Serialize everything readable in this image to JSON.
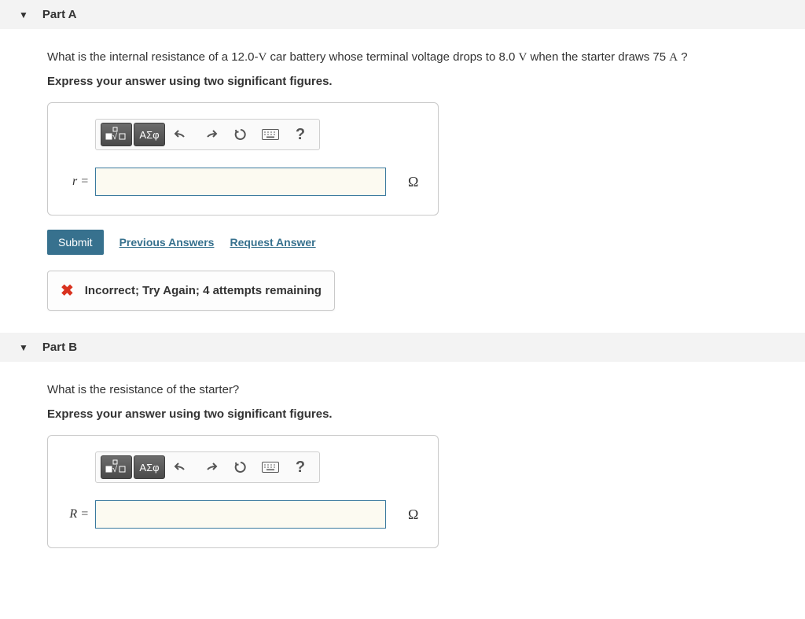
{
  "partA": {
    "title": "Part A",
    "question_pre": "What is the internal resistance of a 12.0-",
    "question_unit1": "V",
    "question_mid": " car battery whose terminal voltage drops to 8.0 ",
    "question_unit2": "V",
    "question_mid2": " when the starter draws 75 ",
    "question_unit3": "A",
    "question_end": " ?",
    "instruction": "Express your answer using two significant figures.",
    "var_label": "r =",
    "unit": "Ω",
    "submit": "Submit",
    "prev_answers": "Previous Answers",
    "request_answer": "Request Answer",
    "feedback": "Incorrect; Try Again; 4 attempts remaining",
    "answer_value": "",
    "toolbar": {
      "greek": "ΑΣφ",
      "help": "?"
    }
  },
  "partB": {
    "title": "Part B",
    "question": "What is the resistance of the starter?",
    "instruction": "Express your answer using two significant figures.",
    "var_label": "R =",
    "unit": "Ω",
    "answer_value": "",
    "toolbar": {
      "greek": "ΑΣφ",
      "help": "?"
    }
  }
}
